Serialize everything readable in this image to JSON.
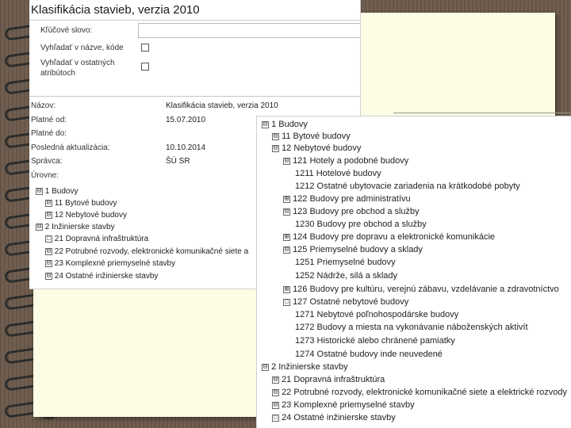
{
  "window1": {
    "title": "Klasifikácia stavieb, verzia 2010",
    "search": {
      "keyword_label": "Kľúčové slovo:",
      "keyword_value": "",
      "name_code_label": "Vyhľadať v názve, kóde",
      "other_attr_label": "Vyhľadať v ostatných atribútoch"
    },
    "details": [
      {
        "label": "Názov:",
        "value": "Klasifikácia stavieb, verzia 2010"
      },
      {
        "label": "Platné od:",
        "value": "15.07.2010"
      },
      {
        "label": "Platné do:",
        "value": ""
      },
      {
        "label": "Posledná aktualizácia:",
        "value": "10.10.2014"
      },
      {
        "label": "Správca:",
        "value": "ŠÚ SR"
      },
      {
        "label": "Úrovne:",
        "value": ""
      }
    ],
    "tree": [
      {
        "toggle": "⊟",
        "label": "1 Budovy"
      },
      {
        "toggle": "⊟",
        "label": "11 Bytové budovy"
      },
      {
        "toggle": "⊟",
        "label": "12 Nebytové budovy"
      },
      {
        "toggle": "⊟",
        "label": "2 Inžinierske stavby"
      },
      {
        "toggle": "☐",
        "label": "21 Dopravná infraštruktúra"
      },
      {
        "toggle": "⊟",
        "label": "22 Potrubné rozvody, elektronické komunikačné siete a"
      },
      {
        "toggle": "⊟",
        "label": "23 Komplexné priemyselné stavby"
      },
      {
        "toggle": "⊟",
        "label": "24 Ostatné inžinierske stavby"
      }
    ]
  },
  "window2": {
    "tree": [
      {
        "toggle": "⊟",
        "label": "1 Budovy"
      },
      {
        "toggle": "⊟",
        "label": "11 Bytové budovy"
      },
      {
        "toggle": "⊟",
        "label": "12 Nebytové budovy"
      },
      {
        "toggle": "⊟",
        "label": "121 Hotely a podobné budovy"
      },
      {
        "toggle": "",
        "label": "1211 Hotelové budovy"
      },
      {
        "toggle": "",
        "label": "1212 Ostatné ubytovacie zariadenia na krátkodobé pobyty"
      },
      {
        "toggle": "⊞",
        "label": "122 Budovy pre administratívu"
      },
      {
        "toggle": "⊟",
        "label": "123 Budovy pre obchod a služby"
      },
      {
        "toggle": "",
        "label": "1230 Budovy pre obchod a služby"
      },
      {
        "toggle": "⊞",
        "label": "124 Budovy pre dopravu a elektronické komunikácie"
      },
      {
        "toggle": "⊟",
        "label": "125 Priemyselné budovy a sklady"
      },
      {
        "toggle": "",
        "label": "1251 Priemyselné budovy"
      },
      {
        "toggle": "",
        "label": "1252 Nádrže, silá a sklady"
      },
      {
        "toggle": "⊞",
        "label": "126 Budovy pre kultúru, verejnú zábavu, vzdelávanie a zdravotníctvo"
      },
      {
        "toggle": "☐",
        "label": "127 Ostatné nebytové budovy"
      },
      {
        "toggle": "",
        "label": "1271 Nebytové poľnohospodárske budovy"
      },
      {
        "toggle": "",
        "label": "1272 Budovy a miesta na vykonávanie náboženských aktivít"
      },
      {
        "toggle": "",
        "label": "1273 Historické alebo chránené pamiatky"
      },
      {
        "toggle": "",
        "label": "1274 Ostatné budovy inde neuvedené"
      },
      {
        "toggle": "⊟",
        "label": "2 Inžinierske stavby"
      },
      {
        "toggle": "⊟",
        "label": "21 Dopravná infraštruktúra"
      },
      {
        "toggle": "⊟",
        "label": "22 Potrubné rozvody, elektronické komunikačné siete a elektrické rozvody"
      },
      {
        "toggle": "⊟",
        "label": "23 Komplexné priemyselné stavby"
      },
      {
        "toggle": "☐",
        "label": "24 Ostatné inžinierske stavby"
      }
    ]
  }
}
